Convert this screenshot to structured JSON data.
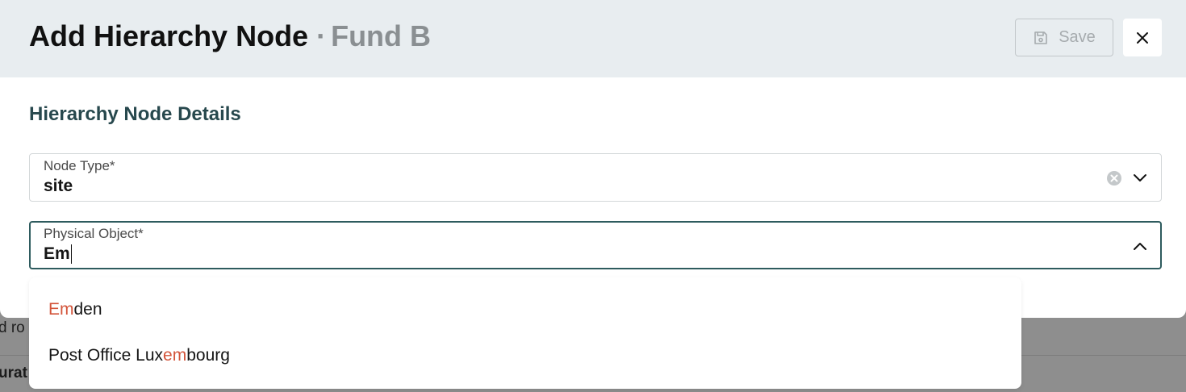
{
  "background": {
    "text_line_1": "d ro",
    "text_line_2": "urat"
  },
  "header": {
    "title": "Add Hierarchy Node",
    "separator": "·",
    "subtitle": "Fund B",
    "save_label": "Save",
    "save_icon": "floppy-disk-icon",
    "close_icon": "close-icon"
  },
  "section": {
    "title": "Hierarchy Node Details"
  },
  "node_type": {
    "label": "Node Type*",
    "value": "site"
  },
  "physical_object": {
    "label": "Physical Object*",
    "value": "Em"
  },
  "options": [
    {
      "before": "",
      "match": "Em",
      "after": "den"
    },
    {
      "before": "Post Office Lux",
      "match": "em",
      "after": "bourg"
    }
  ],
  "colors": {
    "header_bg": "#e8edf0",
    "section_title": "#27484d",
    "focus_border": "#2e5b5e",
    "match_highlight": "#d3543a"
  }
}
